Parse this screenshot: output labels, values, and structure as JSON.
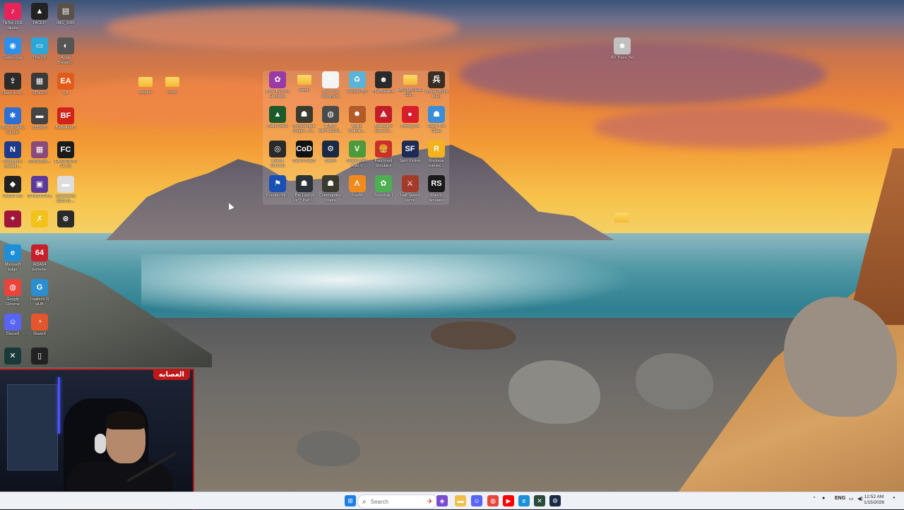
{
  "desktop": {
    "left_column_a": [
      {
        "label": "TikTok LIVE Studio",
        "icon": "tiktok-icon",
        "color": "#e6245a",
        "glyph": "♪"
      },
      {
        "label": "GameLoop",
        "icon": "gameloop-icon",
        "color": "#2c8fe8",
        "glyph": "◉"
      },
      {
        "label": "Share-in-W...",
        "icon": "share-icon",
        "color": "#2b2b2b",
        "glyph": "⇪"
      },
      {
        "label": "Wise Registry Cleaner",
        "icon": "wise-registry-icon",
        "color": "#2d6fd2",
        "glyph": "✱"
      },
      {
        "label": "Naughtiers Individu...",
        "icon": "naughtiers-icon",
        "color": "#1e3a8a",
        "glyph": "N"
      },
      {
        "label": "FACEIT AC",
        "icon": "faceit-ac-icon",
        "color": "#222222",
        "glyph": "◆"
      },
      {
        "label": "",
        "icon": "game-icon",
        "color": "#a0163a",
        "glyph": "✦"
      },
      {
        "label": "Microsoft Edge",
        "icon": "edge-icon",
        "color": "#1c8fd8",
        "glyph": "e"
      },
      {
        "label": "Google Chrome",
        "icon": "chrome-icon",
        "color": "#e9443b",
        "glyph": "◍"
      },
      {
        "label": "Discord",
        "icon": "discord-icon",
        "color": "#5865f2",
        "glyph": "☺"
      },
      {
        "label": "",
        "icon": "terminal-icon",
        "color": "#1a3a3a",
        "glyph": "✕"
      }
    ],
    "left_column_b": [
      {
        "label": "FACEIT",
        "icon": "faceit-icon",
        "color": "#222222",
        "glyph": "▲"
      },
      {
        "label": "This PC",
        "icon": "this-pc-icon",
        "color": "#2ba6d8",
        "glyph": "▭"
      },
      {
        "label": "320x320",
        "icon": "image-icon",
        "color": "#3a3a3a",
        "glyph": "▦"
      },
      {
        "label": "2250x90",
        "icon": "image-icon",
        "color": "#444444",
        "glyph": "▬"
      },
      {
        "label": "2250x20px...",
        "icon": "image-icon",
        "color": "#8a4a7a",
        "glyph": "▦"
      },
      {
        "label": "CPUID CPU-Z",
        "icon": "cpu-z-icon",
        "color": "#5b3a9a",
        "glyph": "▣"
      },
      {
        "label": "",
        "icon": "xsplit-icon",
        "color": "#f2c21b",
        "glyph": "✗"
      },
      {
        "label": "AIDA64 Extreme",
        "icon": "aida64-icon",
        "color": "#c8202a",
        "glyph": "64"
      },
      {
        "label": "Logitech G HUB",
        "icon": "ghub-icon",
        "color": "#2a8fd0",
        "glyph": "G"
      },
      {
        "label": "ShareX",
        "icon": "sharex-icon",
        "color": "#e4562b",
        "glyph": "◔"
      },
      {
        "label": "",
        "icon": "phone-icon",
        "color": "#222222",
        "glyph": "▯"
      }
    ],
    "left_column_c": [
      {
        "label": "IMG_1083",
        "icon": "image-icon",
        "color": "#5a5148",
        "glyph": "▤"
      },
      {
        "label": "Apple Breako...",
        "icon": "apple-icon",
        "color": "#555555",
        "glyph": "◐"
      },
      {
        "label": "EA",
        "icon": "ea-icon",
        "color": "#e35b1a",
        "glyph": "EA"
      },
      {
        "label": "Battlefield 6",
        "icon": "battlefield-icon",
        "color": "#d0231a",
        "glyph": "BF"
      },
      {
        "label": "EA SPORTS FC 26",
        "icon": "fc26-icon",
        "color": "#1b1b1b",
        "glyph": "FC"
      },
      {
        "label": "Screenshot 2025-11-...",
        "icon": "screenshot-icon",
        "color": "#dddddd",
        "glyph": "▬"
      },
      {
        "label": "",
        "icon": "openai-icon",
        "color": "#2a2a2a",
        "glyph": "⊛"
      }
    ],
    "folders_mid": [
      {
        "label": "plugins",
        "icon": "folder-icon"
      },
      {
        "label": "mods",
        "icon": "folder-icon"
      }
    ],
    "group": [
      {
        "label": "Drive Beyond Horizons",
        "icon": "drive-beyond-icon",
        "color": "#9a3aa8",
        "glyph": "✿"
      },
      {
        "label": "smoth",
        "icon": "folder-icon",
        "color": "#f2c04a",
        "glyph": ""
      },
      {
        "label": "New Text Document",
        "icon": "text-document-icon",
        "color": "#f4f4f4",
        "glyph": "≡"
      },
      {
        "label": "Recycle Bin",
        "icon": "recycle-bin-icon",
        "color": "#5bb3d6",
        "glyph": "♻"
      },
      {
        "label": "The Break-in",
        "icon": "the-break-in-icon",
        "color": "#2a2a2a",
        "glyph": "☻"
      },
      {
        "label": "ABU MASHAL GR...",
        "icon": "folder-icon",
        "color": "#e0b73a",
        "glyph": ""
      },
      {
        "label": "Where Winds Meet",
        "icon": "where-winds-icon",
        "color": "#3a2e22",
        "glyph": "兵"
      },
      {
        "label": "Delta Force",
        "icon": "delta-force-icon",
        "color": "#1b5a2a",
        "glyph": "▲"
      },
      {
        "label": "Commandos: Origins - D...",
        "icon": "commandos-icon",
        "color": "#3a3a2e",
        "glyph": "☗"
      },
      {
        "label": "PUBG: BATTLEGR...",
        "icon": "pubg-icon",
        "color": "#4a4a4a",
        "glyph": "◍"
      },
      {
        "label": "Mafia: Definitiv...",
        "icon": "mafia-icon",
        "color": "#b35a2a",
        "glyph": "✹"
      },
      {
        "label": "Assassin's Creed S...",
        "icon": "assassins-creed-icon",
        "color": "#c21d28",
        "glyph": "⟁"
      },
      {
        "label": "Among Us",
        "icon": "among-us-icon",
        "color": "#d81e2a",
        "glyph": "●"
      },
      {
        "label": "Carry The Glass",
        "icon": "carry-glass-icon",
        "color": "#3a8ed8",
        "glyph": "☗"
      },
      {
        "label": "Ubisoft Connect",
        "icon": "ubisoft-icon",
        "color": "#2a2a2a",
        "glyph": "◎"
      },
      {
        "label": "Call of Duty®",
        "icon": "call-of-duty-icon",
        "color": "#111111",
        "glyph": "CoD"
      },
      {
        "label": "Steam",
        "icon": "steam-icon",
        "color": "#1b2a44",
        "glyph": "⚙"
      },
      {
        "label": "Grand Theft Auto V",
        "icon": "gta-icon",
        "color": "#4c9a3a",
        "glyph": "V"
      },
      {
        "label": "Fast Food Simulator",
        "icon": "fast-food-icon",
        "color": "#c9302a",
        "glyph": "🍔"
      },
      {
        "label": "Spirit Fiction",
        "icon": "spirit-fiction-icon",
        "color": "#1d2b55",
        "glyph": "SF"
      },
      {
        "label": "Rockstar Games ...",
        "icon": "rockstar-icon",
        "color": "#f2b31c",
        "glyph": "R"
      },
      {
        "label": "Counter-Str...",
        "icon": "counter-strike-icon",
        "color": "#1a4fb3",
        "glyph": "⚑"
      },
      {
        "label": "The Last of Us™ Part I...",
        "icon": "last-of-us-icon",
        "color": "#2a3138",
        "glyph": "☗"
      },
      {
        "label": "Commandos: Origins",
        "icon": "commandos-icon",
        "color": "#3a3a2e",
        "glyph": "☗"
      },
      {
        "label": "FiveM",
        "icon": "fivem-icon",
        "color": "#f08a1c",
        "glyph": "Λ"
      },
      {
        "label": "Schedule I",
        "icon": "schedule-icon",
        "color": "#4caf50",
        "glyph": "✿"
      },
      {
        "label": "Half Sword Demo",
        "icon": "half-sword-icon",
        "color": "#a33a2a",
        "glyph": "⚔"
      },
      {
        "label": "Ranch Simulator",
        "icon": "ranch-simulator-icon",
        "color": "#1a1a1a",
        "glyph": "RS"
      }
    ],
    "right_icon": {
      "label": "RV There Yet",
      "icon": "rv-there-yet-icon",
      "color": "#c0c0c0",
      "glyph": "☻"
    },
    "stray_folder": {
      "label": "",
      "icon": "folder-icon"
    }
  },
  "webcam": {
    "badge": "العصابه"
  },
  "taskbar": {
    "search_placeholder": "Search",
    "language": "ENG",
    "time": "12:52 AM",
    "date": "1/15/2026",
    "apps": [
      {
        "name": "start-button",
        "icon": "windows-icon",
        "color": "#1d7fe6",
        "glyph": "⊞"
      },
      {
        "name": "taskbar-game",
        "icon": "game-icon",
        "color": "#7a4ad0",
        "glyph": "◈"
      },
      {
        "name": "taskbar-file-explorer",
        "icon": "file-explorer-icon",
        "color": "#f2c04a",
        "glyph": "▬"
      },
      {
        "name": "taskbar-discord",
        "icon": "discord-icon",
        "color": "#5865f2",
        "glyph": "☺"
      },
      {
        "name": "taskbar-chrome",
        "icon": "chrome-icon",
        "color": "#e9443b",
        "glyph": "◍"
      },
      {
        "name": "taskbar-youtube",
        "icon": "youtube-icon",
        "color": "#ff0000",
        "glyph": "▶"
      },
      {
        "name": "taskbar-edge",
        "icon": "edge-icon",
        "color": "#1c8fd8",
        "glyph": "e"
      },
      {
        "name": "taskbar-terminal",
        "icon": "terminal-icon",
        "color": "#2a4a3a",
        "glyph": "✕"
      },
      {
        "name": "taskbar-steam",
        "icon": "steam-icon",
        "color": "#1b2a44",
        "glyph": "⚙"
      }
    ]
  }
}
